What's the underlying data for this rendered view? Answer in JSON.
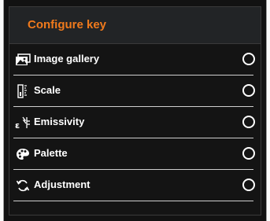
{
  "header": {
    "title": "Configure key",
    "title_color": "#f07a1c"
  },
  "options": [
    {
      "label": "Image gallery",
      "icon": "image-gallery-icon",
      "selected": false
    },
    {
      "label": "Scale",
      "icon": "scale-icon",
      "selected": false
    },
    {
      "label": "Emissivity",
      "icon": "emissivity-icon",
      "selected": false
    },
    {
      "label": "Palette",
      "icon": "palette-icon",
      "selected": false
    },
    {
      "label": "Adjustment",
      "icon": "adjustment-icon",
      "selected": false
    }
  ],
  "colors": {
    "background": "#141414",
    "header_background": "#222426",
    "text": "#ffffff",
    "divider": "#cfcfcf"
  },
  "icon_glyphs": {
    "emissivity_prefix": "ε"
  }
}
